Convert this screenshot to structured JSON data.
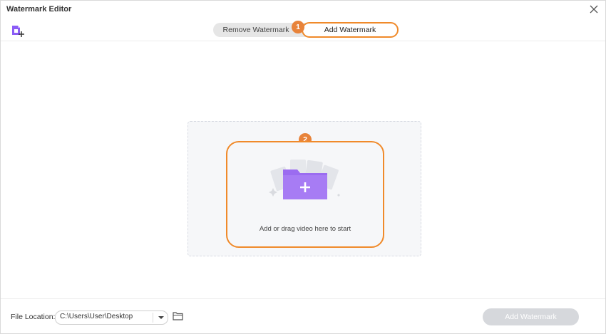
{
  "window": {
    "title": "Watermark Editor"
  },
  "icons": {
    "close": "close-icon",
    "add_file": "add-file-icon",
    "folder": "folder-icon",
    "dropdown": "chevron-down-icon"
  },
  "tabs": [
    {
      "label": "Remove Watermark",
      "active": false
    },
    {
      "label": "Add Watermark",
      "active": true
    }
  ],
  "badges": {
    "step1": "1",
    "step2": "2"
  },
  "dropzone": {
    "text": "Add or drag video here to start"
  },
  "footer": {
    "location_label": "File Location:",
    "location_value": "C:\\Users\\User\\Desktop",
    "add_button": "Add Watermark"
  },
  "colors": {
    "accent": "#f08a2a",
    "badge": "#e8833a",
    "folder": "#9b6cf0",
    "disabled_button": "#d6d8dc"
  }
}
